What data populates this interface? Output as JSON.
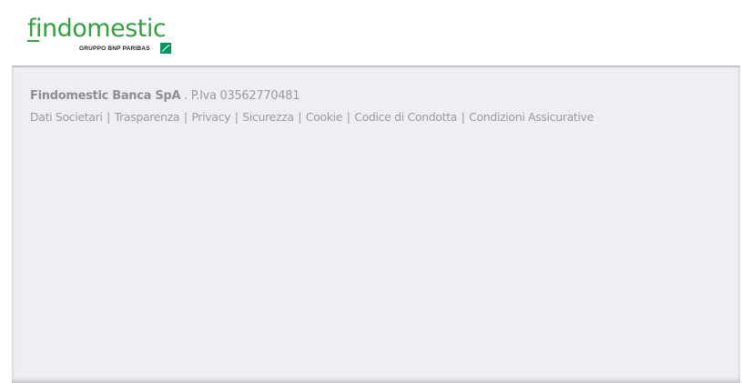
{
  "header": {
    "logo": {
      "wordmark": "findomestic",
      "tagline": "GRUPPO BNP PARIBAS",
      "brand_color": "#35a040",
      "mark_color": "#00965e",
      "mark_icon": "bnp-paribas-stars-icon"
    }
  },
  "footer": {
    "company_name": "Findomestic Banca SpA",
    "vat_separator": ".",
    "vat_text": "P.Iva 03562770481",
    "link_separator": "|",
    "links": [
      {
        "label": "Dati Societari"
      },
      {
        "label": "Trasparenza"
      },
      {
        "label": "Privacy"
      },
      {
        "label": "Sicurezza"
      },
      {
        "label": "Cookie"
      },
      {
        "label": "Codice di Condotta"
      },
      {
        "label": "Condizioni Assicurative"
      }
    ],
    "background_color": "#efeff3",
    "text_color": "#9a9aa0"
  }
}
